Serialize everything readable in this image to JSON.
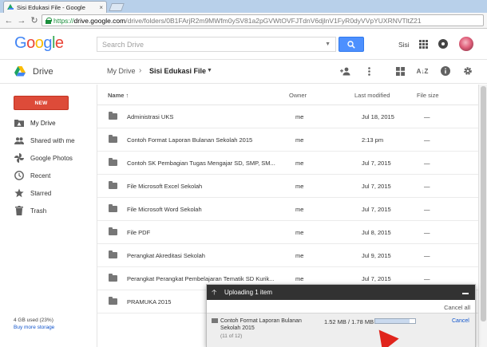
{
  "browser": {
    "tab_title": "Sisi Edukasi File - Google",
    "tab_close": "×",
    "url_scheme": "https://",
    "url_host": "drive.google.com",
    "url_path": "/drive/folders/0B1FArjR2m9MWfm0ySV81a2pGVWtOVFJTdnV6djlnV1FyR0dyVVpYUXRNVTltZ21"
  },
  "header": {
    "logo": "Google",
    "search_placeholder": "Search Drive",
    "user_name": "Sisi",
    "brand_colors": [
      "#4285f4",
      "#ea4335",
      "#fbbc05",
      "#4285f4",
      "#34a853",
      "#ea4335"
    ]
  },
  "toolbar": {
    "app_name": "Drive",
    "breadcrumb_root": "My Drive",
    "breadcrumb_separator": "›",
    "breadcrumb_current": "Sisi Edukasi File",
    "icons": [
      "share-person-icon",
      "more-vert-icon",
      "grid-view-icon",
      "sort-az-icon",
      "info-icon",
      "settings-icon"
    ]
  },
  "sidebar": {
    "new_label": "NEW",
    "items": [
      {
        "label": "My Drive",
        "icon": "drive-folder-icon",
        "active": true
      },
      {
        "label": "Shared with me",
        "icon": "people-icon",
        "active": false
      },
      {
        "label": "Google Photos",
        "icon": "photos-pinwheel-icon",
        "active": false
      },
      {
        "label": "Recent",
        "icon": "clock-icon",
        "active": false
      },
      {
        "label": "Starred",
        "icon": "star-icon",
        "active": false
      },
      {
        "label": "Trash",
        "icon": "trash-icon",
        "active": false
      }
    ],
    "storage_used": "4 GB used (23%)",
    "buy_storage": "Buy more storage"
  },
  "list": {
    "columns": {
      "name": "Name",
      "sort_arrow": "↑",
      "owner": "Owner",
      "modified": "Last modified",
      "size": "File size"
    },
    "rows": [
      {
        "name": "Administrasi UKS",
        "owner": "me",
        "modified": "Jul 18, 2015",
        "size": "—"
      },
      {
        "name": "Contoh Format Laporan Bulanan Sekolah 2015",
        "owner": "me",
        "modified": "2:13 pm",
        "size": "—"
      },
      {
        "name": "Contoh SK Pembagian Tugas Mengajar SD, SMP, SM...",
        "owner": "me",
        "modified": "Jul 7, 2015",
        "size": "—"
      },
      {
        "name": "File Microsoft Excel Sekolah",
        "owner": "me",
        "modified": "Jul 7, 2015",
        "size": "—"
      },
      {
        "name": "File Microsoft Word Sekolah",
        "owner": "me",
        "modified": "Jul 7, 2015",
        "size": "—"
      },
      {
        "name": "File PDF",
        "owner": "me",
        "modified": "Jul 8, 2015",
        "size": "—"
      },
      {
        "name": "Perangkat Akreditasi Sekolah",
        "owner": "me",
        "modified": "Jul 9, 2015",
        "size": "—"
      },
      {
        "name": "Perangkat Perangkat Pembelajaran Tematik SD Kurik...",
        "owner": "me",
        "modified": "Jul 7, 2015",
        "size": "—"
      },
      {
        "name": "PRAMUKA 2015",
        "owner": "",
        "modified": "",
        "size": ""
      }
    ]
  },
  "upload": {
    "title": "Uploading 1 item",
    "cancel_all": "Cancel all",
    "file_name": "Contoh Format Laporan Bulanan Sekolah 2015",
    "file_count": "(11 of 12)",
    "progress_text": "1.52 MB / 1.78 MB",
    "progress_fraction": 0.854,
    "cancel": "Cancel"
  }
}
